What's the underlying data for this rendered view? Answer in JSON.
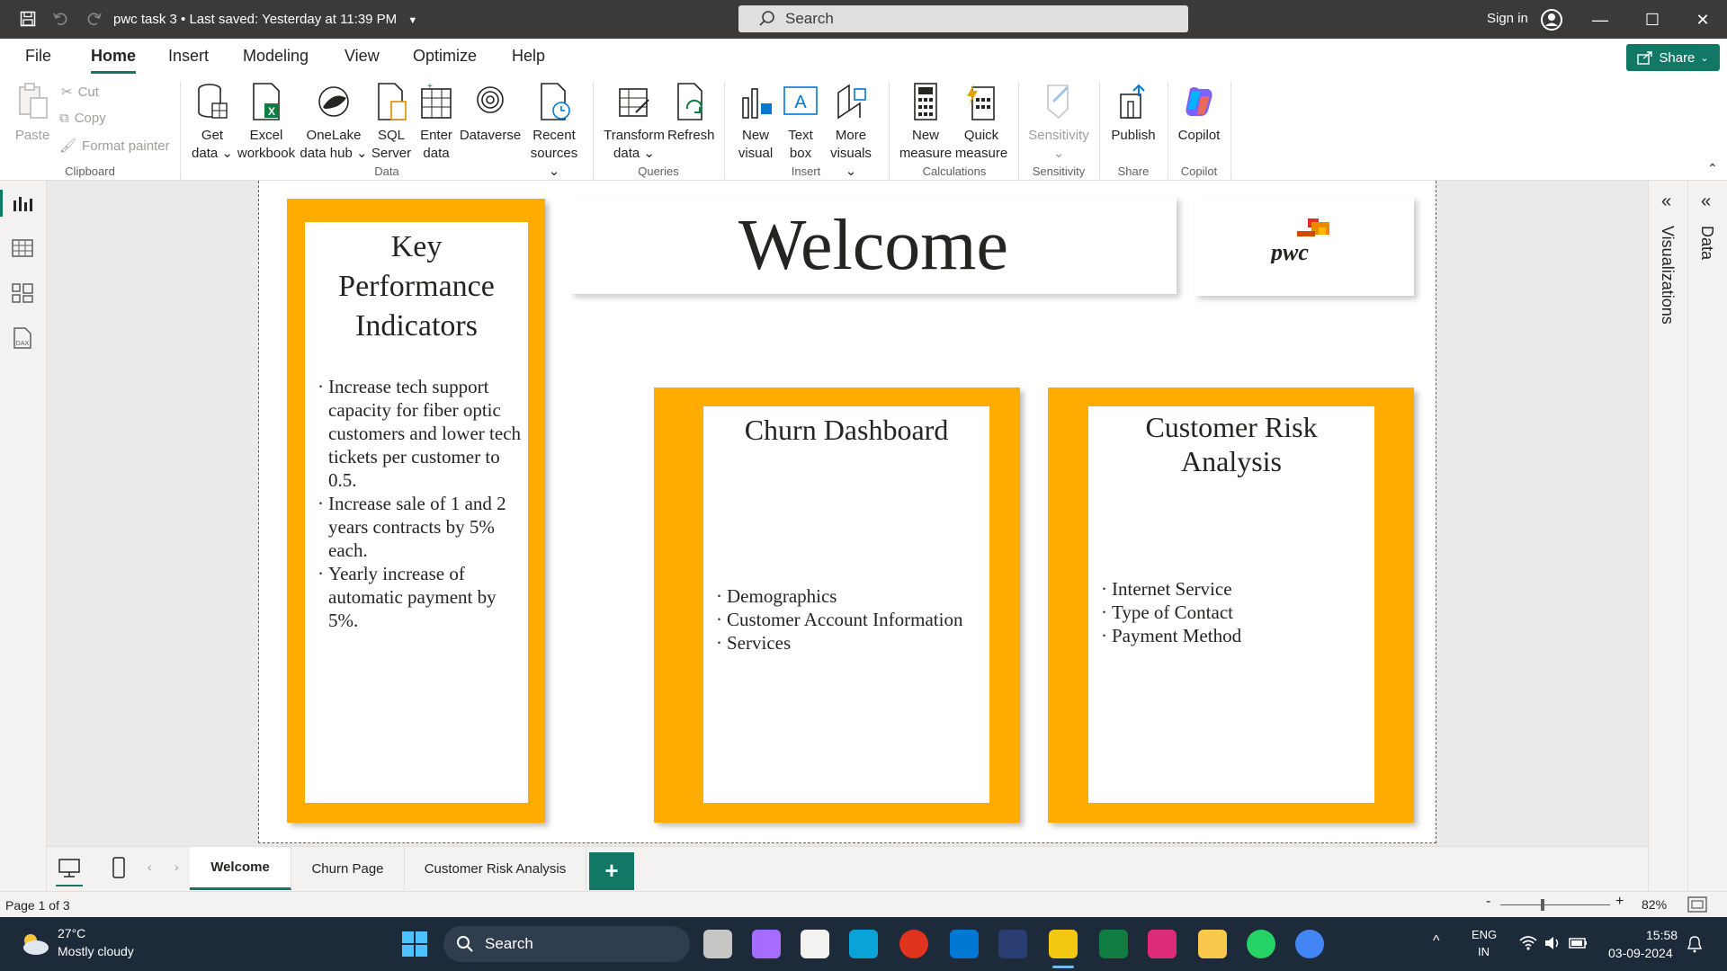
{
  "titlebar": {
    "file_name": "pwc task 3",
    "saved_status": "Last saved: Yesterday at 11:39 PM",
    "search_placeholder": "Search",
    "signin_label": "Sign in"
  },
  "menu": {
    "tabs": [
      "File",
      "Home",
      "Insert",
      "Modeling",
      "View",
      "Optimize",
      "Help"
    ],
    "active_tab": "Home",
    "share_label": "Share"
  },
  "ribbon": {
    "clipboard": {
      "paste": "Paste",
      "cut": "Cut",
      "copy": "Copy",
      "format_painter": "Format painter",
      "group": "Clipboard"
    },
    "data": {
      "get_data": [
        "Get",
        "data"
      ],
      "excel": [
        "Excel",
        "workbook"
      ],
      "onelake": [
        "OneLake",
        "data hub"
      ],
      "sql": [
        "SQL",
        "Server"
      ],
      "enter": [
        "Enter",
        "data"
      ],
      "dataverse": "Dataverse",
      "recent": [
        "Recent",
        "sources"
      ],
      "group": "Data"
    },
    "queries": {
      "transform": [
        "Transform",
        "data"
      ],
      "refresh": "Refresh",
      "group": "Queries"
    },
    "insert": {
      "new_visual": [
        "New",
        "visual"
      ],
      "text_box": [
        "Text",
        "box"
      ],
      "more_visuals": [
        "More",
        "visuals"
      ],
      "group": "Insert"
    },
    "calculations": {
      "new_measure": [
        "New",
        "measure"
      ],
      "quick_measure": [
        "Quick",
        "measure"
      ],
      "group": "Calculations"
    },
    "sensitivity": {
      "label": "Sensitivity",
      "group": "Sensitivity"
    },
    "share": {
      "publish": "Publish",
      "group": "Share"
    },
    "copilot": {
      "label": "Copilot",
      "group": "Copilot"
    }
  },
  "report": {
    "kpi": {
      "title": "Key Performance Indicators",
      "bullets": [
        "Increase tech support capacity for fiber optic customers and lower tech tickets per customer to 0.5.",
        "Increase sale of 1 and 2 years contracts by 5% each.",
        " Yearly increase of automatic payment by 5%."
      ]
    },
    "welcome_title": "Welcome",
    "logo_text": "pwc",
    "churn": {
      "title": "Churn Dashboard",
      "bullets": [
        "Demographics",
        "Customer Account Information",
        "Services"
      ]
    },
    "risk": {
      "title": "Customer Risk Analysis",
      "bullets": [
        "Internet Service",
        "Type of Contact",
        "Payment Method"
      ]
    },
    "orange_color": "#ffab00"
  },
  "panes": {
    "visualizations": "Visualizations",
    "data": "Data"
  },
  "page_tabs": [
    "Welcome",
    "Churn Page",
    "Customer Risk Analysis"
  ],
  "active_page": "Welcome",
  "status": {
    "page_info": "Page 1 of 3",
    "zoom": "82%"
  },
  "taskbar": {
    "weather_temp": "27°C",
    "weather_desc": "Mostly cloudy",
    "search_label": "Search",
    "lang1": "ENG",
    "lang2": "IN",
    "time": "15:58",
    "date": "03-09-2024"
  }
}
